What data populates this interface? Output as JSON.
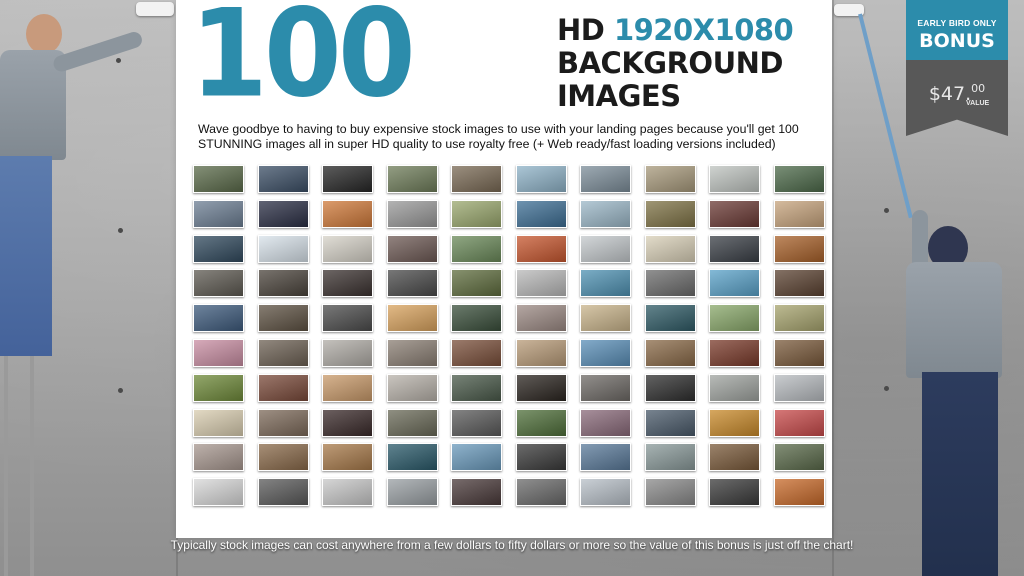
{
  "hero": {
    "number": "100",
    "headline_line1_prefix": "HD ",
    "headline_line1_accent": "1920X1080",
    "headline_line2": "BACKGROUND",
    "headline_line3": "IMAGES",
    "intro": "Wave goodbye to having to buy expensive stock images to use with your landing pages because you'll get 100 STUNNING images all in super HD quality to use royalty free (+ Web ready/fast loading versions included)"
  },
  "badge": {
    "small_label": "EARLY BIRD ONLY",
    "big_label": "BONUS",
    "price_main": "$47.",
    "price_cents": "00",
    "value_label": "VALUE"
  },
  "footer": {
    "text": "Typically stock images can cost anywhere from a few dollars to fifty dollars or more so the value of this bonus is just off the chart!"
  },
  "colors": {
    "accent": "#2c8cab",
    "dark_text": "#1b1b1b",
    "badge_dark": "#585858"
  },
  "grid": {
    "rows": 10,
    "columns": 10,
    "thumbnail_tints": [
      "#5b6b4a",
      "#3c4f66",
      "#262626",
      "#6f7d5a",
      "#7a6a55",
      "#8fb3c8",
      "#7d8e9a",
      "#a89a7c",
      "#bfc4c0",
      "#4d6a4a",
      "#6d7f94",
      "#2b2f45",
      "#d07a3a",
      "#9a9a9a",
      "#9aa86e",
      "#3e6f95",
      "#9cb8c8",
      "#7f7346",
      "#6b3a35",
      "#c7a47d",
      "#314a5e",
      "#d8e2ea",
      "#d6d2c8",
      "#6e5a55",
      "#6b8a5a",
      "#c7572f",
      "#c4c9cc",
      "#d9d0b8",
      "#3a3f46",
      "#a8612a",
      "#5e5a52",
      "#4b443c",
      "#3b3230",
      "#4a4a4a",
      "#5f6d3e",
      "#b9b9b9",
      "#4f92b3",
      "#6c6c6c",
      "#5aa2c9",
      "#5b4231",
      "#3e5b7d",
      "#5e5243",
      "#4c4c4c",
      "#d9a35e",
      "#3a4f3b",
      "#9c8a84",
      "#c9b48b",
      "#2f5b66",
      "#89a86a",
      "#a7a46e",
      "#c98ea3",
      "#6d6154",
      "#b0aca6",
      "#8b7f74",
      "#7a4f3a",
      "#b89b78",
      "#5a8fb8",
      "#8a6a48",
      "#7a3a2a",
      "#7a5a3b",
      "#6f8a3a",
      "#7a4a3a",
      "#c99a6a",
      "#b8b2aa",
      "#4a5a4a",
      "#2b2520",
      "#6e6a66",
      "#2e2e2e",
      "#a0a4a0",
      "#b8bcc0",
      "#d9cdb0",
      "#7d6a5a",
      "#3a2a2a",
      "#6a6a58",
      "#5a5a5a",
      "#4f6f3a",
      "#8a6a7a",
      "#4a5a6a",
      "#c98a2a",
      "#c84a4a",
      "#a89890",
      "#8a6a4a",
      "#a87a4a",
      "#2a5a6a",
      "#6a9abc",
      "#3a3a3a",
      "#5a7a9a",
      "#8a9a9a",
      "#7a5a3a",
      "#5a6a4a",
      "#d8d8d8",
      "#5a5a5a",
      "#c8c8c8",
      "#9aa0a4",
      "#4a3a3a",
      "#6a6a6a",
      "#b8c0c8",
      "#8a8a8a",
      "#3a3a3a",
      "#c86a2a"
    ]
  }
}
